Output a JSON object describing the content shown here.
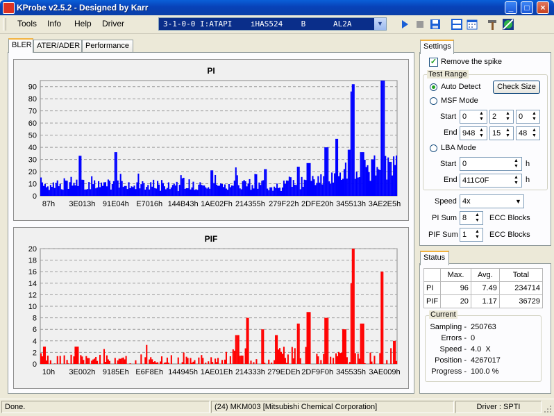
{
  "window": {
    "title": "KProbe v2.5.2 - Designed by Karr",
    "controls": [
      "_",
      "□",
      "×"
    ]
  },
  "menu": [
    "Tools",
    "Info",
    "Help",
    "Driver"
  ],
  "drive": {
    "selected": "3-1-0-0 I:ATAPI    iHAS524    B      AL2A"
  },
  "toolbar_icons": [
    "play-icon",
    "stop-icon",
    "save-icon",
    "split-view-icon",
    "calendar-icon",
    "tools-icon",
    "disc-scan-icon"
  ],
  "tabs": [
    "BLER",
    "ATER/ADER",
    "Performance"
  ],
  "colors": {
    "pi": "#0000ff",
    "pif": "#ff0000",
    "accent": "#0a4ec9"
  },
  "chart_data": [
    {
      "type": "bar",
      "title": "PI",
      "ylim": [
        0,
        95
      ],
      "yticks": [
        0,
        10,
        20,
        30,
        40,
        50,
        60,
        70,
        80,
        90
      ],
      "xtick_labels": [
        "87h",
        "3E013h",
        "91E04h",
        "E7016h",
        "144B43h",
        "1AE02Fh",
        "214355h",
        "279F22h",
        "2DFE20h",
        "345513h",
        "3AE2E5h"
      ],
      "grid": true,
      "peaks": [
        {
          "x": 0.11,
          "y": 33
        },
        {
          "x": 0.21,
          "y": 36
        },
        {
          "x": 0.48,
          "y": 21
        },
        {
          "x": 0.63,
          "y": 22
        },
        {
          "x": 0.72,
          "y": 24
        },
        {
          "x": 0.75,
          "y": 27
        },
        {
          "x": 0.8,
          "y": 40
        },
        {
          "x": 0.83,
          "y": 47
        },
        {
          "x": 0.865,
          "y": 38
        },
        {
          "x": 0.872,
          "y": 86
        },
        {
          "x": 0.875,
          "y": 92
        },
        {
          "x": 0.9,
          "y": 36
        },
        {
          "x": 0.93,
          "y": 30
        },
        {
          "x": 0.955,
          "y": 86
        },
        {
          "x": 0.958,
          "y": 96
        },
        {
          "x": 0.98,
          "y": 28
        }
      ]
    },
    {
      "type": "bar",
      "title": "PIF",
      "ylim": [
        0,
        20
      ],
      "yticks": [
        0,
        2,
        4,
        6,
        8,
        10,
        12,
        14,
        16,
        18,
        20
      ],
      "xtick_labels": [
        "10h",
        "3E002h",
        "9185Eh",
        "E6F8Eh",
        "144945h",
        "1AE01Eh",
        "214333h",
        "279EDEh",
        "2DF9F0h",
        "345535h",
        "3AE009h"
      ],
      "grid": true,
      "peaks": [
        {
          "x": 0.01,
          "y": 3
        },
        {
          "x": 0.1,
          "y": 3
        },
        {
          "x": 0.55,
          "y": 5
        },
        {
          "x": 0.58,
          "y": 8
        },
        {
          "x": 0.62,
          "y": 6
        },
        {
          "x": 0.66,
          "y": 5
        },
        {
          "x": 0.72,
          "y": 7
        },
        {
          "x": 0.75,
          "y": 9
        },
        {
          "x": 0.8,
          "y": 8
        },
        {
          "x": 0.85,
          "y": 6
        },
        {
          "x": 0.87,
          "y": 14
        },
        {
          "x": 0.874,
          "y": 20
        },
        {
          "x": 0.9,
          "y": 7
        },
        {
          "x": 0.955,
          "y": 16
        },
        {
          "x": 0.99,
          "y": 4
        }
      ]
    }
  ],
  "settings": {
    "header": "Settings",
    "remove_spike": "Remove the spike",
    "test_range": "Test Range",
    "auto_detect": "Auto Detect",
    "check_size": "Check Size",
    "msf_mode": "MSF Mode",
    "start_label": "Start",
    "end_label": "End",
    "msf_start": [
      "0",
      "2",
      "0"
    ],
    "msf_end": [
      "948",
      "15",
      "48"
    ],
    "lba_mode": "LBA Mode",
    "lba_start": "0",
    "lba_end": "411C0F",
    "h_unit": "h",
    "speed_label": "Speed",
    "speed_value": "4x",
    "pi_sum_label": "PI Sum",
    "pi_sum_value": "8",
    "pif_sum_label": "PIF Sum",
    "pif_sum_value": "1",
    "ecc_blocks": "ECC Blocks"
  },
  "status": {
    "header": "Status",
    "columns": [
      "",
      "Max.",
      "Avg.",
      "Total"
    ],
    "rows": [
      {
        "label": "PI",
        "max": "96",
        "avg": "7.49",
        "total": "234714"
      },
      {
        "label": "PIF",
        "max": "20",
        "avg": "1.17",
        "total": "36729"
      }
    ],
    "current_label": "Current",
    "sampling_label": "Sampling -",
    "sampling_value": "250763",
    "errors_label": "Errors -",
    "errors_value": "0",
    "speed_label": "Speed -",
    "speed_value": "4.0  X",
    "position_label": "Position -",
    "position_value": "4267017",
    "progress_label": "Progress -",
    "progress_value": "100.0 %"
  },
  "statusbar": {
    "left": "Done.",
    "middle": "(24) MKM003 [Mitsubishi Chemical Corporation]",
    "right": "Driver : SPTI"
  }
}
